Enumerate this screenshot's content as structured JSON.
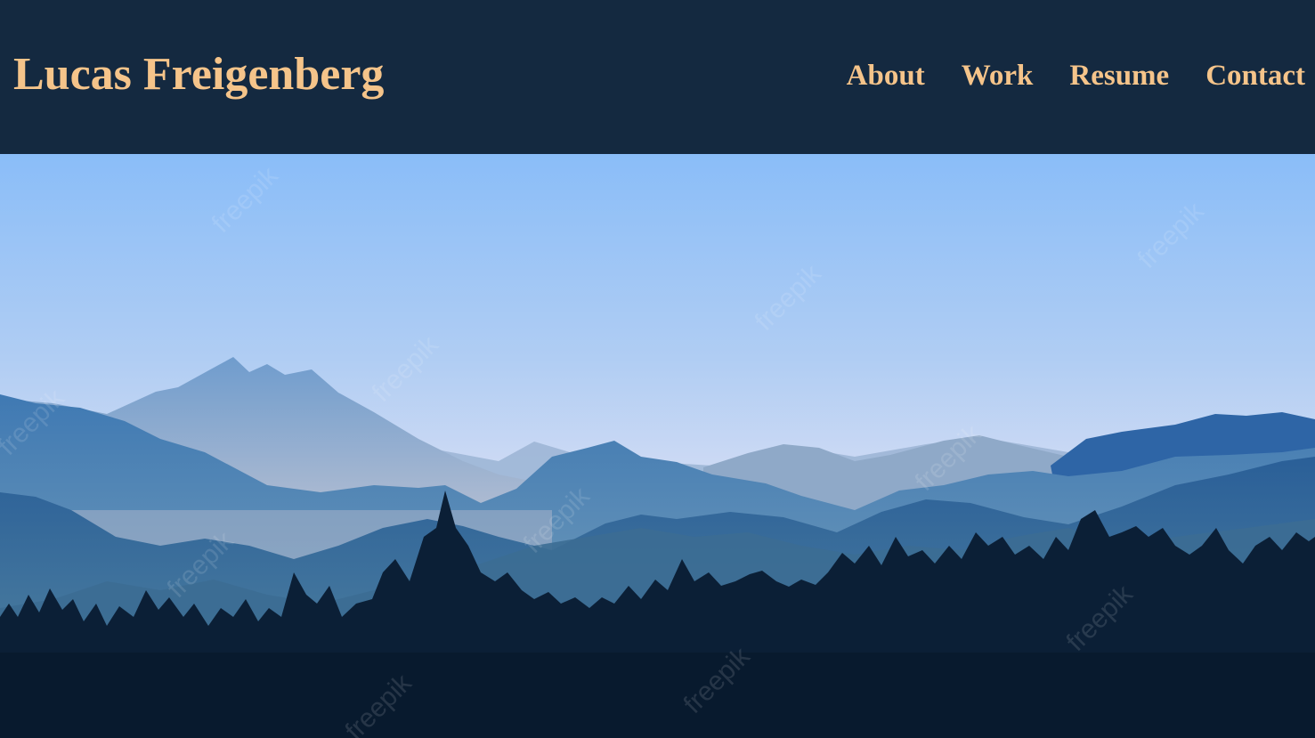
{
  "colors": {
    "header_bg": "#142940",
    "accent": "#f5c48a"
  },
  "header": {
    "title": "Lucas Freigenberg",
    "nav": [
      {
        "label": "About"
      },
      {
        "label": "Work"
      },
      {
        "label": "Resume"
      },
      {
        "label": "Contact"
      }
    ]
  },
  "hero": {
    "image": "mountain-forest-landscape-illustration",
    "watermark": "freepik"
  }
}
